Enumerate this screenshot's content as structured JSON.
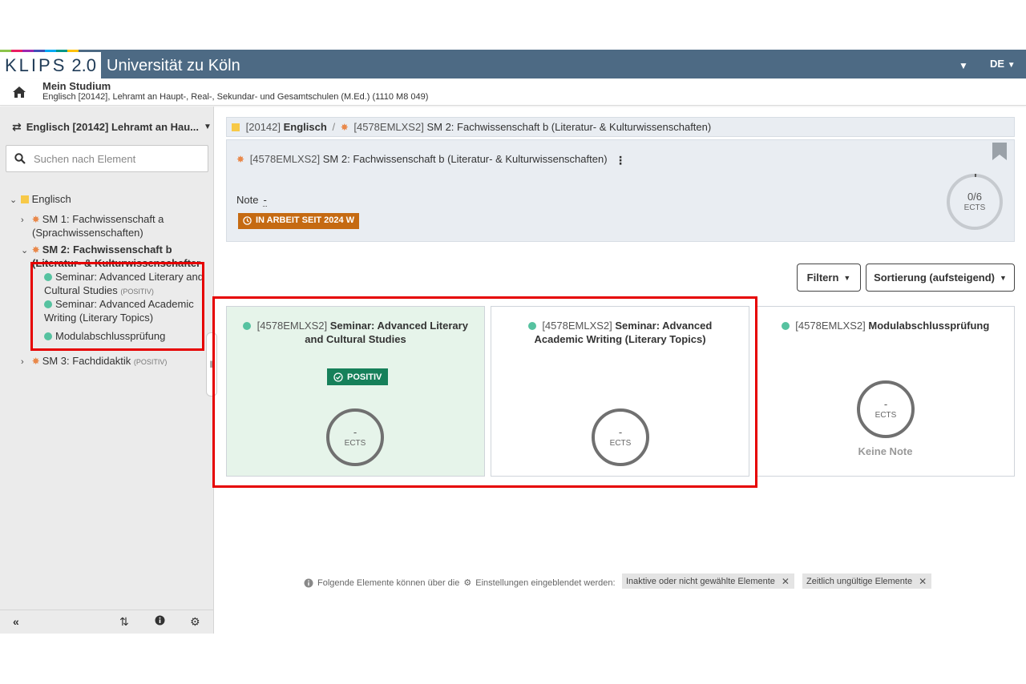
{
  "colors": {
    "header_bg": "#4d6a84",
    "accent_orange": "#c56a12",
    "positive_green": "#16805a",
    "element_dot": "#56c2a0",
    "highlight_red": "#e60000",
    "strip": [
      "#8bc34a",
      "#e91e63",
      "#9c27b0",
      "#3f51b5",
      "#03a9f4",
      "#009688",
      "#ffc107",
      "#4d6a84"
    ]
  },
  "header": {
    "logo": "KLIPS",
    "logo_version": "2.0",
    "university": "Universität zu Köln",
    "language": "DE"
  },
  "subheader": {
    "title": "Mein Studium",
    "program": "Englisch [20142], Lehramt an Haupt-, Real-, Sekundar- und Gesamtschulen (M.Ed.) (1110 M8 049)"
  },
  "sidebar": {
    "switcher_label": "Englisch [20142] Lehramt an Hau...",
    "search_placeholder": "Suchen nach Element",
    "tree": {
      "root": "Englisch",
      "sm1_line1": "SM 1: Fachwissenschaft a",
      "sm1_line2": "(Sprachwissenschaften)",
      "sm2_line1": "SM 2: Fachwissenschaft b",
      "sm2_line2": "(Literatur- & Kulturwissenschaften)",
      "el1_line1": "Seminar: Advanced Literary and",
      "el1_line2": "Cultural Studies",
      "el1_status": "(POSITIV)",
      "el2_line1": "Seminar: Advanced Academic",
      "el2_line2": "Writing (Literary Topics)",
      "el3": "Modulabschlussprüfung",
      "sm3": "SM 3: Fachdidaktik",
      "sm3_status": "(POSITIV)"
    }
  },
  "breadcrumb": {
    "root_code": "[20142]",
    "root_name": "Englisch",
    "sep": "/",
    "module_code": "[4578EMLXS2]",
    "module_name": "SM 2: Fachwissenschaft b (Literatur- & Kulturwissenschaften)"
  },
  "module": {
    "code": "[4578EMLXS2]",
    "name": "SM 2: Fachwissenschaft b (Literatur- & Kulturwissenschaften)",
    "note_label": "Note",
    "note_value": "-",
    "status": "IN ARBEIT SEIT 2024 W",
    "ects_value": "0/6",
    "ects_unit": "ECTS"
  },
  "toolbar": {
    "filter_label": "Filtern",
    "sort_label": "Sortierung (aufsteigend)"
  },
  "elements": [
    {
      "code": "[4578EMLXS2]",
      "name": "Seminar: Advanced Literary and Cultural Studies",
      "status": "POSITIV",
      "ects_value": "-",
      "ects_unit": "ECTS"
    },
    {
      "code": "[4578EMLXS2]",
      "name": "Seminar: Advanced Academic Writing (Literary Topics)",
      "ects_value": "-",
      "ects_unit": "ECTS"
    },
    {
      "code": "[4578EMLXS2]",
      "name": "Modulabschlussprüfung",
      "ects_value": "-",
      "ects_unit": "ECTS",
      "grade_text": "Keine Note"
    }
  ],
  "footer": {
    "note_before": "Folgende Elemente können über die",
    "note_after": "Einstellungen eingeblendet werden:",
    "tag1": "Inaktive oder nicht gewählte Elemente",
    "tag2": "Zeitlich ungültige Elemente"
  }
}
